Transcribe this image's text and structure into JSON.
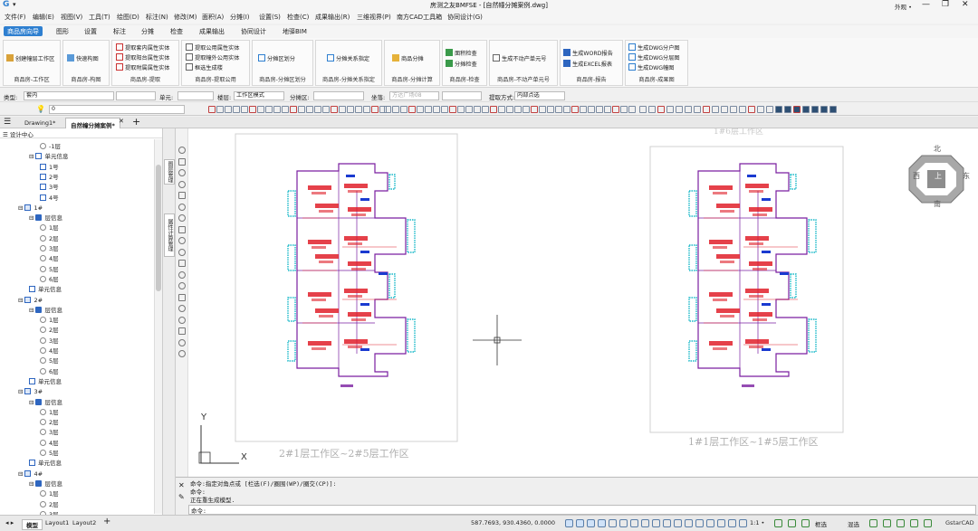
{
  "app": {
    "title": "房测之友BMFSE - [自然幢分摊案例.dwg]",
    "layout_menu": "外观 •"
  },
  "menu": [
    "文件(F)",
    "编辑(E)",
    "视图(V)",
    "工具(T)",
    "绘图(D)",
    "标注(N)",
    "修改(M)",
    "面积(A)",
    "分摊(I)",
    "设置(S)",
    "检查(C)",
    "成果输出(R)",
    "三维视界(P)",
    "南方CAD工具箱",
    "协同设计(G)"
  ],
  "ribbon_tabs": [
    "商品房向导",
    "图形",
    "设置",
    "标注",
    "分摊",
    "检查",
    "成果输出",
    "协同设计",
    "地驿BIM"
  ],
  "ribbon": {
    "g1": {
      "btn": "创建幢层工作区",
      "label": "商品房-工作区"
    },
    "g2": {
      "btn": "快速构图",
      "label": "商品房-构图"
    },
    "g3": {
      "btns": [
        "提取套内属性实体",
        "提取阳台属性实体",
        "提取附属属性实体"
      ],
      "label": "商品房-提取"
    },
    "g4": {
      "btns": [
        "提取公用属性实体",
        "提取幢外公用实体",
        "框选生成楼"
      ],
      "label": "商品房-提取公用"
    },
    "g5": {
      "btn": "分摊区划分",
      "label": "商品房-分摊区划分"
    },
    "g6": {
      "btn": "分摊关系指定",
      "label": "商品房-分摊关系指定"
    },
    "g7": {
      "btn": "商品分摊",
      "label": "商品房-分摊计算"
    },
    "g8": {
      "btns": [
        "面积检查",
        "分摊检查"
      ],
      "label": "商品房-检查"
    },
    "g9": {
      "btn": "生成不动产单元号",
      "label": "商品房-不动产单元号"
    },
    "g10": {
      "btns": [
        "生成WORD报告",
        "生成EXCEL报表"
      ],
      "label": "商品房-报告"
    },
    "g11": {
      "btns": [
        "生成DWG分户图",
        "生成DWG分层图",
        "生成DWG幢图"
      ],
      "label": "商品房-成果图"
    }
  },
  "propbar": {
    "type_label": "类型:",
    "type_value": "套内",
    "unit_label": "单元:",
    "floor_label": "楼层:",
    "floor_value": "工作区模式",
    "area_label": "分摊区:",
    "search_placeholder": "方达广场08",
    "extract_label": "提取方式:",
    "extract_value": "内部点选",
    "layer_value": "0",
    "reset_label": "坐落:"
  },
  "doc_tabs": [
    "Drawing1*",
    "自然幢分摊案例*"
  ],
  "panel": {
    "title": "设计中心"
  },
  "tree": [
    {
      "indent": 3,
      "icon": "eye-icon",
      "label": "-1层"
    },
    {
      "indent": 2,
      "icon": "a-icon",
      "label": "单元信息",
      "expand": "-"
    },
    {
      "indent": 3,
      "icon": "a-icon",
      "label": "1号"
    },
    {
      "indent": 3,
      "icon": "a-icon",
      "label": "2号"
    },
    {
      "indent": 3,
      "icon": "a-icon",
      "label": "3号"
    },
    {
      "indent": 3,
      "icon": "a-icon",
      "label": "4号"
    },
    {
      "indent": 1,
      "icon": "building-icon",
      "label": "1#",
      "expand": "-"
    },
    {
      "indent": 2,
      "icon": "layers-icon",
      "label": "层信息",
      "expand": "-"
    },
    {
      "indent": 3,
      "icon": "eye-icon",
      "label": "1层"
    },
    {
      "indent": 3,
      "icon": "eye-icon",
      "label": "2层"
    },
    {
      "indent": 3,
      "icon": "eye-icon",
      "label": "3层"
    },
    {
      "indent": 3,
      "icon": "eye-icon",
      "label": "4层"
    },
    {
      "indent": 3,
      "icon": "eye-icon",
      "label": "5层"
    },
    {
      "indent": 3,
      "icon": "eye-icon",
      "label": "6层"
    },
    {
      "indent": 2,
      "icon": "a-icon",
      "label": "单元信息"
    },
    {
      "indent": 1,
      "icon": "building-icon",
      "label": "2#",
      "expand": "-"
    },
    {
      "indent": 2,
      "icon": "layers-icon",
      "label": "层信息",
      "expand": "-"
    },
    {
      "indent": 3,
      "icon": "eye-icon",
      "label": "1层"
    },
    {
      "indent": 3,
      "icon": "eye-icon",
      "label": "2层"
    },
    {
      "indent": 3,
      "icon": "eye-icon",
      "label": "3层"
    },
    {
      "indent": 3,
      "icon": "eye-icon",
      "label": "4层"
    },
    {
      "indent": 3,
      "icon": "eye-icon",
      "label": "5层"
    },
    {
      "indent": 3,
      "icon": "eye-icon",
      "label": "6层"
    },
    {
      "indent": 2,
      "icon": "a-icon",
      "label": "单元信息"
    },
    {
      "indent": 1,
      "icon": "building-icon",
      "label": "3#",
      "expand": "-"
    },
    {
      "indent": 2,
      "icon": "layers-icon",
      "label": "层信息",
      "expand": "-"
    },
    {
      "indent": 3,
      "icon": "eye-icon",
      "label": "1层"
    },
    {
      "indent": 3,
      "icon": "eye-icon",
      "label": "2层"
    },
    {
      "indent": 3,
      "icon": "eye-icon",
      "label": "3层"
    },
    {
      "indent": 3,
      "icon": "eye-icon",
      "label": "4层"
    },
    {
      "indent": 3,
      "icon": "eye-icon",
      "label": "5层"
    },
    {
      "indent": 2,
      "icon": "a-icon",
      "label": "单元信息"
    },
    {
      "indent": 1,
      "icon": "building-icon",
      "label": "4#",
      "expand": "-"
    },
    {
      "indent": 2,
      "icon": "layers-icon",
      "label": "层信息",
      "expand": "-"
    },
    {
      "indent": 3,
      "icon": "eye-icon",
      "label": "1层"
    },
    {
      "indent": 3,
      "icon": "eye-icon",
      "label": "2层"
    },
    {
      "indent": 3,
      "icon": "eye-icon",
      "label": "3层"
    }
  ],
  "vtabs": [
    "图层管理",
    "属性计算管理"
  ],
  "canvas": {
    "left_caption": "2#1层工作区~2#5层工作区",
    "right_caption": "1#1层工作区~1#5层工作区",
    "right_top_caption": "1#6层工作区",
    "ucs_x": "X",
    "ucs_y": "Y",
    "compass": {
      "n": "北",
      "s": "南",
      "e": "东",
      "w": "西",
      "top": "上"
    }
  },
  "command": {
    "lines": [
      "命令:指定对角点或 [栏选(F)/圈围(WP)/圈交(CP)]:",
      "命令:",
      "正在重生成模型.",
      "命令:"
    ]
  },
  "status": {
    "tabs": [
      "模型",
      "Layout1",
      "Layout2"
    ],
    "coords": "587.7693, 930.4360, 0.0000",
    "scale": "1:1 •",
    "right1": "框选",
    "right2": "混选",
    "brand": "GstarCAD"
  },
  "colors": {
    "accent": "#2e7fd0",
    "plan_purple": "#7a1fa0",
    "plan_red": "#e0202a",
    "plan_cyan": "#18b8c8",
    "plan_blue": "#1a3ad0"
  }
}
